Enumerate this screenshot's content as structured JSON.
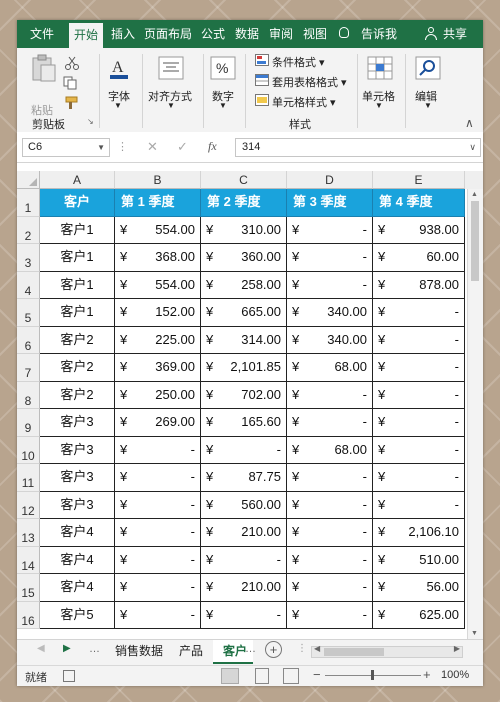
{
  "ribbon_tabs": [
    "文件",
    "开始",
    "插入",
    "页面布局",
    "公式",
    "数据",
    "审阅",
    "视图",
    "告诉我",
    "共享"
  ],
  "ribbon": {
    "paste": "粘贴",
    "clipboard": "剪贴板",
    "font": "字体",
    "align": "对齐方式",
    "number": "数字",
    "cond_format": "条件格式",
    "table_format": "套用表格格式",
    "cell_style": "单元格样式",
    "styles": "样式",
    "cells": "单元格",
    "editing": "编辑"
  },
  "formula_bar": {
    "name_box": "C6",
    "fx": "fx",
    "value": "314"
  },
  "columns": [
    "A",
    "B",
    "C",
    "D",
    "E"
  ],
  "header_row": [
    "客户",
    "第 1 季度",
    "第 2 季度",
    "第 3 季度",
    "第 4 季度"
  ],
  "currency": "¥",
  "rows": [
    {
      "n": "2",
      "c": [
        "客户1",
        "554.00",
        "310.00",
        "-",
        "938.00"
      ]
    },
    {
      "n": "3",
      "c": [
        "客户1",
        "368.00",
        "360.00",
        "-",
        "60.00"
      ]
    },
    {
      "n": "4",
      "c": [
        "客户1",
        "554.00",
        "258.00",
        "-",
        "878.00"
      ]
    },
    {
      "n": "5",
      "c": [
        "客户1",
        "152.00",
        "665.00",
        "340.00",
        "-"
      ]
    },
    {
      "n": "6",
      "c": [
        "客户2",
        "225.00",
        "314.00",
        "340.00",
        "-"
      ]
    },
    {
      "n": "7",
      "c": [
        "客户2",
        "369.00",
        "2,101.85",
        "68.00",
        "-"
      ]
    },
    {
      "n": "8",
      "c": [
        "客户2",
        "250.00",
        "702.00",
        "-",
        "-"
      ]
    },
    {
      "n": "9",
      "c": [
        "客户3",
        "269.00",
        "165.60",
        "-",
        "-"
      ]
    },
    {
      "n": "10",
      "c": [
        "客户3",
        "-",
        "-",
        "68.00",
        "-"
      ]
    },
    {
      "n": "11",
      "c": [
        "客户3",
        "-",
        "87.75",
        "-",
        "-"
      ]
    },
    {
      "n": "12",
      "c": [
        "客户3",
        "-",
        "560.00",
        "-",
        "-"
      ]
    },
    {
      "n": "13",
      "c": [
        "客户4",
        "-",
        "210.00",
        "-",
        "2,106.10"
      ]
    },
    {
      "n": "14",
      "c": [
        "客户4",
        "-",
        "-",
        "-",
        "510.00"
      ]
    },
    {
      "n": "15",
      "c": [
        "客户4",
        "-",
        "210.00",
        "-",
        "56.00"
      ]
    },
    {
      "n": "16",
      "c": [
        "客户5",
        "-",
        "-",
        "-",
        "625.00"
      ]
    }
  ],
  "first_row_num": "1",
  "sheet_tabs": [
    "销售数据",
    "产品",
    "客户"
  ],
  "status": {
    "ready": "就绪",
    "zoom": "100%"
  }
}
